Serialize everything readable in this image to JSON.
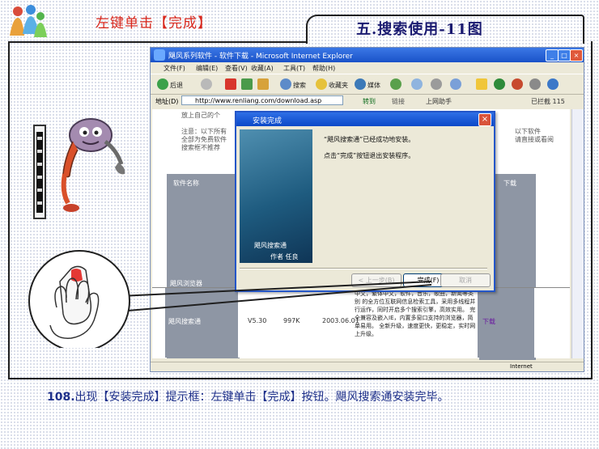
{
  "header": {
    "instruction": "左键单击【完成】",
    "section": "五.搜索使用-11图"
  },
  "ie": {
    "title": "飓风系列软件 - 软件下载 - Microsoft Internet Explorer",
    "menu": [
      "文件(F)",
      "编辑(E)",
      "查看(V)",
      "收藏(A)",
      "工具(T)",
      "帮助(H)"
    ],
    "toolbar": [
      "后退",
      "搜索",
      "收藏夹",
      "媒体"
    ],
    "address_label": "地址(D)",
    "address": "http://www.renliang.com/download.asp",
    "go": "转到",
    "links": "链接",
    "addon": "上网助手",
    "tb_count": "已拦截 115",
    "status": "Internet"
  },
  "page": {
    "line1": "放上自己的个",
    "line2": "注意：以下所有",
    "line3": "全部为免费软件",
    "line4": "搜索框不推荐",
    "right1": "以下软件",
    "right2": "请直接或看阅",
    "col_software": "软件名称",
    "col_download": "下载",
    "row1_name": "飓风浏览器",
    "row2_name": "飓风搜索通",
    "row2_ver": "V5.30",
    "row2_size": "997K",
    "row2_date": "2003.06.01",
    "row2_desc": "中文，繁体中文，软件，音乐，歌曲，新闻等类别 的全方位互联网信息检索工具，采用多线程并行运作，同时开启多个搜索引擎，高效实用。 完全兼容及嵌入IE，内置多窗口支持的浏览器，简单易用。 全新升级，速度更快，更稳定，实时网上升级。",
    "row2_link": "下载"
  },
  "dialog": {
    "title": "安装完成",
    "msg1": "“飓风搜索通”已经成功地安装。",
    "msg2": "点击“完成”按钮退出安装程序。",
    "side_label": "飓风搜索通",
    "side_author": "作者 任良",
    "btn_back": "< 上一步(B)",
    "btn_finish": "完成(F)",
    "btn_cancel": "取消"
  },
  "caption": {
    "num": "108.",
    "text": "出现【安装完成】提示框：左键单击【完成】按钮。飓风搜索通安装完毕。"
  },
  "colors": {
    "accent_red": "#d8271c",
    "caption_blue": "#1d2f8a",
    "xp_blue": "#1a52c8"
  }
}
